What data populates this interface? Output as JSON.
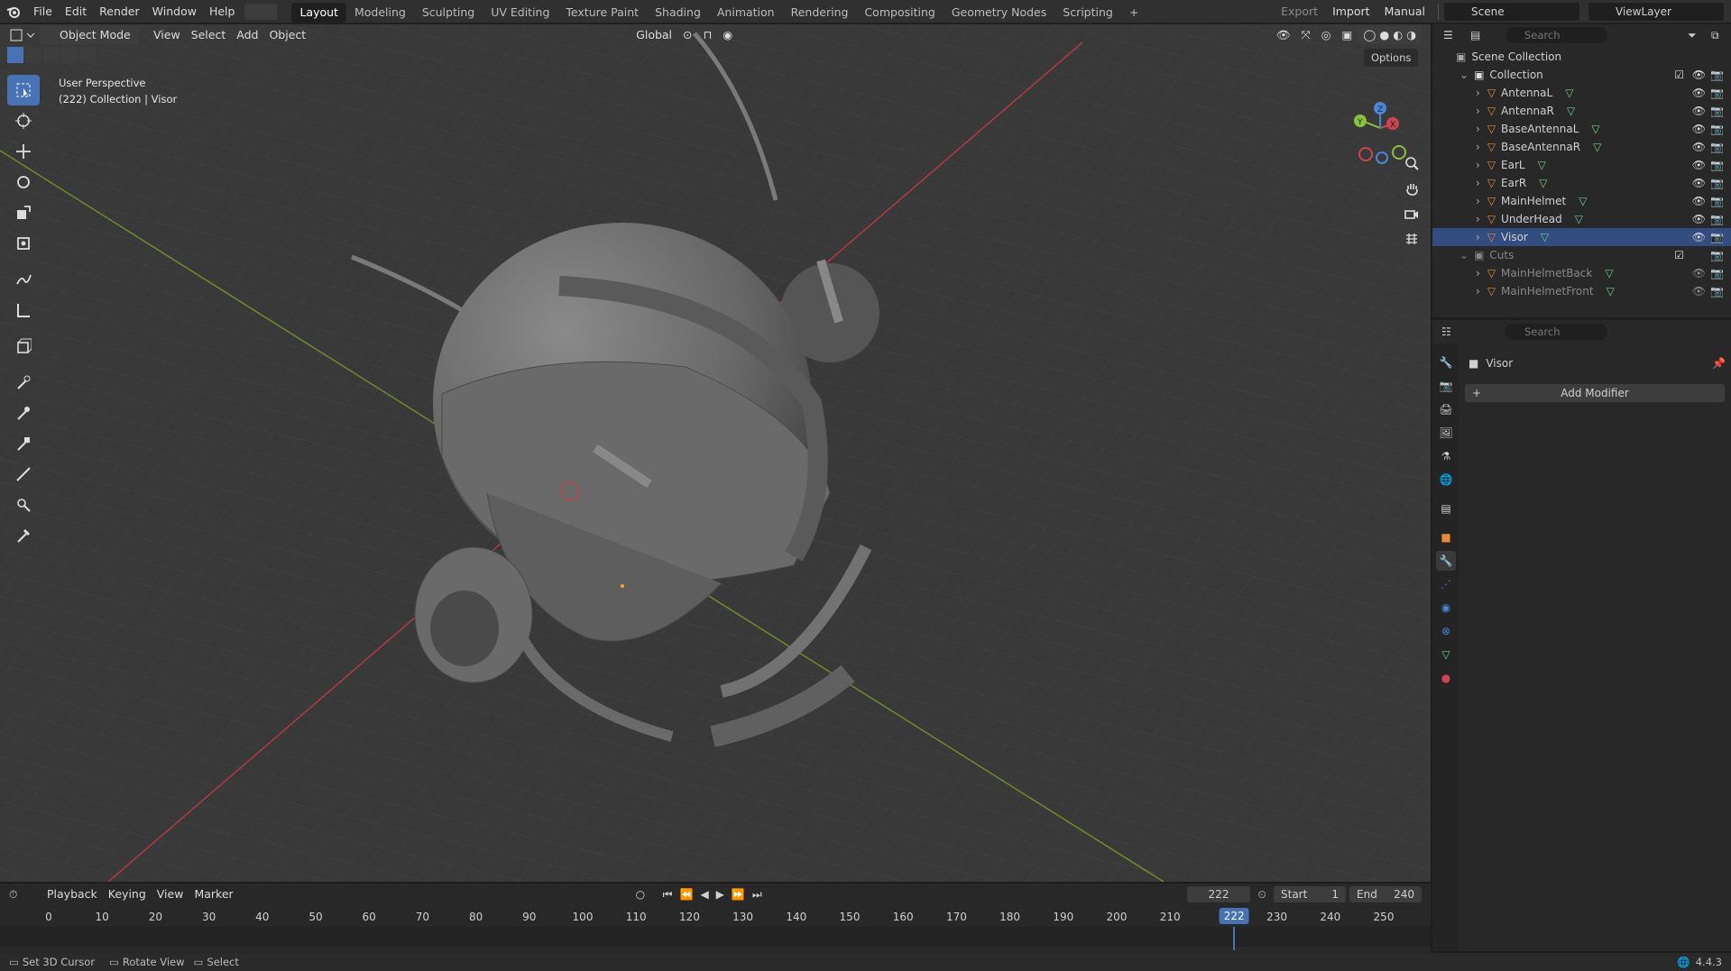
{
  "topbar": {
    "menus": [
      "File",
      "Edit",
      "Render",
      "Window",
      "Help"
    ],
    "workspaces": [
      "Layout",
      "Modeling",
      "Sculpting",
      "UV Editing",
      "Texture Paint",
      "Shading",
      "Animation",
      "Rendering",
      "Compositing",
      "Geometry Nodes",
      "Scripting"
    ],
    "active_workspace": "Layout",
    "export_label": "Export",
    "import_label": "Import",
    "manual_label": "Manual",
    "scene_label": "Scene",
    "viewlayer_label": "ViewLayer"
  },
  "viewport_header": {
    "mode": "Object Mode",
    "menus": [
      "View",
      "Select",
      "Add",
      "Object"
    ],
    "orientation": "Global",
    "options_label": "Options"
  },
  "viewport": {
    "perspective_label": "User Perspective",
    "collection_label": "(222) Collection | Visor"
  },
  "outliner": {
    "search_placeholder": "Search",
    "scene_collection": "Scene Collection",
    "collection": "Collection",
    "objects": [
      "AntennaL",
      "AntennaR",
      "BaseAntennaL",
      "BaseAntennaR",
      "EarL",
      "EarR",
      "MainHelmet",
      "UnderHead",
      "Visor"
    ],
    "cuts_collection": "Cuts",
    "cut_objects": [
      "MainHelmetBack",
      "MainHelmetFront"
    ]
  },
  "properties": {
    "search_placeholder": "Search",
    "object_name": "Visor",
    "add_modifier_label": "Add Modifier"
  },
  "timeline": {
    "menus": [
      "Playback",
      "Keying",
      "View",
      "Marker"
    ],
    "current_frame": "222",
    "start_label": "Start",
    "start_value": "1",
    "end_label": "End",
    "end_value": "240",
    "ticks": [
      "0",
      "10",
      "20",
      "30",
      "40",
      "50",
      "60",
      "70",
      "80",
      "90",
      "100",
      "110",
      "120",
      "130",
      "140",
      "150",
      "160",
      "170",
      "180",
      "190",
      "200",
      "210",
      "2",
      "230",
      "240",
      "250"
    ],
    "playhead_label": "222"
  },
  "statusbar": {
    "items": [
      "Set 3D Cursor",
      "Rotate View",
      "Select"
    ],
    "version": "4.4.3"
  },
  "colors": {
    "accent": "#4772b3",
    "object_orange": "#e58a3a",
    "mesh_green": "#6ccf8a",
    "x_axis": "#cc4352",
    "y_axis": "#8ac13d",
    "z_axis": "#4a86d6"
  }
}
